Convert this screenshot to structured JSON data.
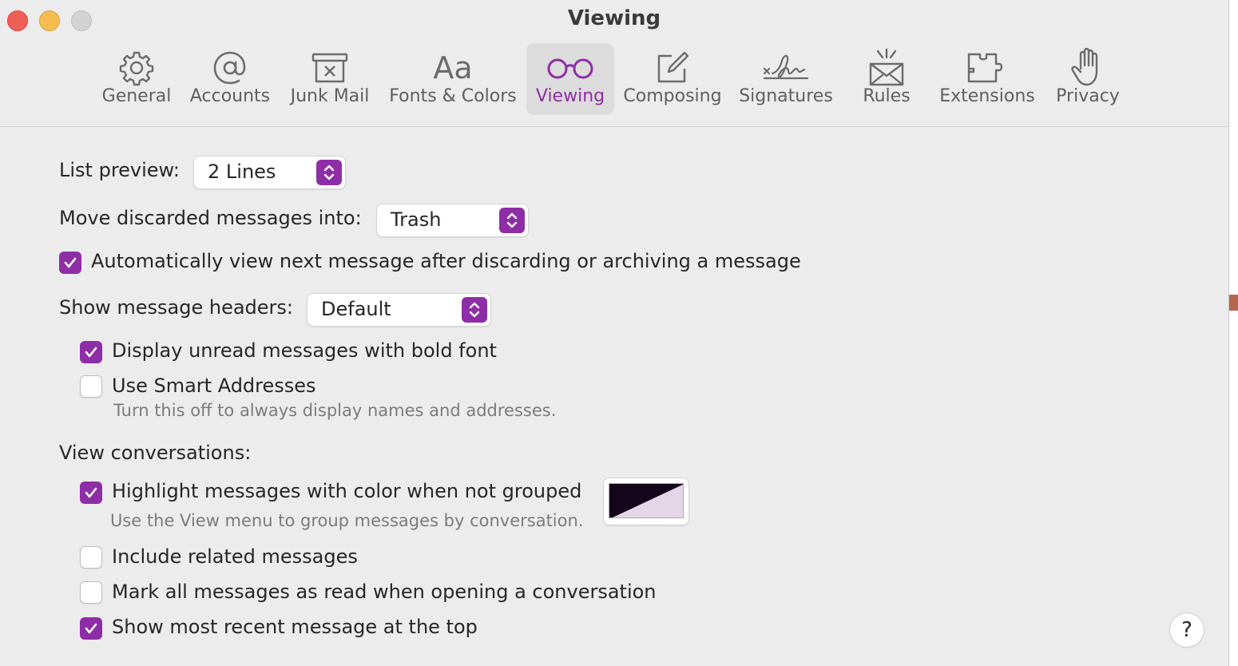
{
  "window": {
    "title": "Viewing"
  },
  "tabs": [
    {
      "label": "General",
      "icon": "gear-icon"
    },
    {
      "label": "Accounts",
      "icon": "at-sign-icon"
    },
    {
      "label": "Junk Mail",
      "icon": "junk-tray-icon"
    },
    {
      "label": "Fonts & Colors",
      "icon": "font-aa-icon"
    },
    {
      "label": "Viewing",
      "icon": "glasses-icon",
      "active": true
    },
    {
      "label": "Composing",
      "icon": "compose-icon"
    },
    {
      "label": "Signatures",
      "icon": "signature-icon"
    },
    {
      "label": "Rules",
      "icon": "rules-envelope-icon"
    },
    {
      "label": "Extensions",
      "icon": "puzzle-icon"
    },
    {
      "label": "Privacy",
      "icon": "hand-icon"
    }
  ],
  "settings": {
    "list_preview": {
      "label": "List preview:",
      "value": "2 Lines"
    },
    "move_discarded": {
      "label": "Move discarded messages into:",
      "value": "Trash"
    },
    "auto_view_next": {
      "label": "Automatically view next message after discarding or archiving a message",
      "checked": true
    },
    "show_headers": {
      "label": "Show message headers:",
      "value": "Default"
    },
    "display_unread_bold": {
      "label": "Display unread messages with bold font",
      "checked": true
    },
    "smart_addresses": {
      "label": "Use Smart Addresses",
      "checked": false,
      "hint": "Turn this off to always display names and addresses."
    },
    "view_conversations": {
      "label": "View conversations:"
    },
    "highlight_color": {
      "label": "Highlight messages with color when not grouped",
      "checked": true,
      "hint": "Use the View menu to group messages by conversation.",
      "color_dark": "#14061a",
      "color_light": "#e4d6e6"
    },
    "include_related": {
      "label": "Include related messages",
      "checked": false
    },
    "mark_all_read": {
      "label": "Mark all messages as read when opening a conversation",
      "checked": false
    },
    "most_recent_top": {
      "label": "Show most recent message at the top",
      "checked": true
    }
  },
  "help": {
    "label": "?"
  },
  "colors": {
    "accent": "#8e2ea6",
    "background": "#ececec"
  }
}
